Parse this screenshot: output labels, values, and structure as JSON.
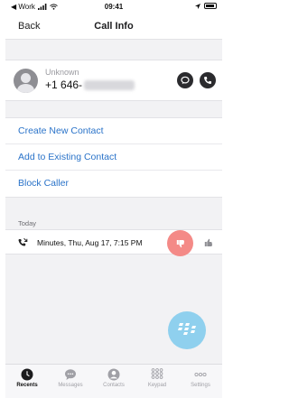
{
  "status_bar": {
    "carrier": "◀ Work",
    "time": "09:41"
  },
  "header": {
    "back_label": "Back",
    "title": "Call Info"
  },
  "contact": {
    "name": "Unknown",
    "number_prefix": "+1 646-"
  },
  "actions": [
    {
      "label": "Create New Contact"
    },
    {
      "label": "Add to Existing Contact"
    },
    {
      "label": "Block Caller"
    }
  ],
  "history": {
    "section_label": "Today",
    "entries": [
      {
        "text": "Minutes, Thu, Aug 17, 7:15 PM"
      }
    ]
  },
  "tabs": [
    {
      "label": "Recents",
      "icon": "clock-icon",
      "active": true
    },
    {
      "label": "Messages",
      "icon": "chat-bubble-icon",
      "active": false
    },
    {
      "label": "Contacts",
      "icon": "person-icon",
      "active": false
    },
    {
      "label": "Keypad",
      "icon": "keypad-icon",
      "active": false
    },
    {
      "label": "Settings",
      "icon": "more-icon",
      "active": false
    }
  ],
  "colors": {
    "link_blue": "#2a73c9",
    "thumb_down_bg": "#f48a87",
    "fab_bg": "#8fd0ee"
  }
}
